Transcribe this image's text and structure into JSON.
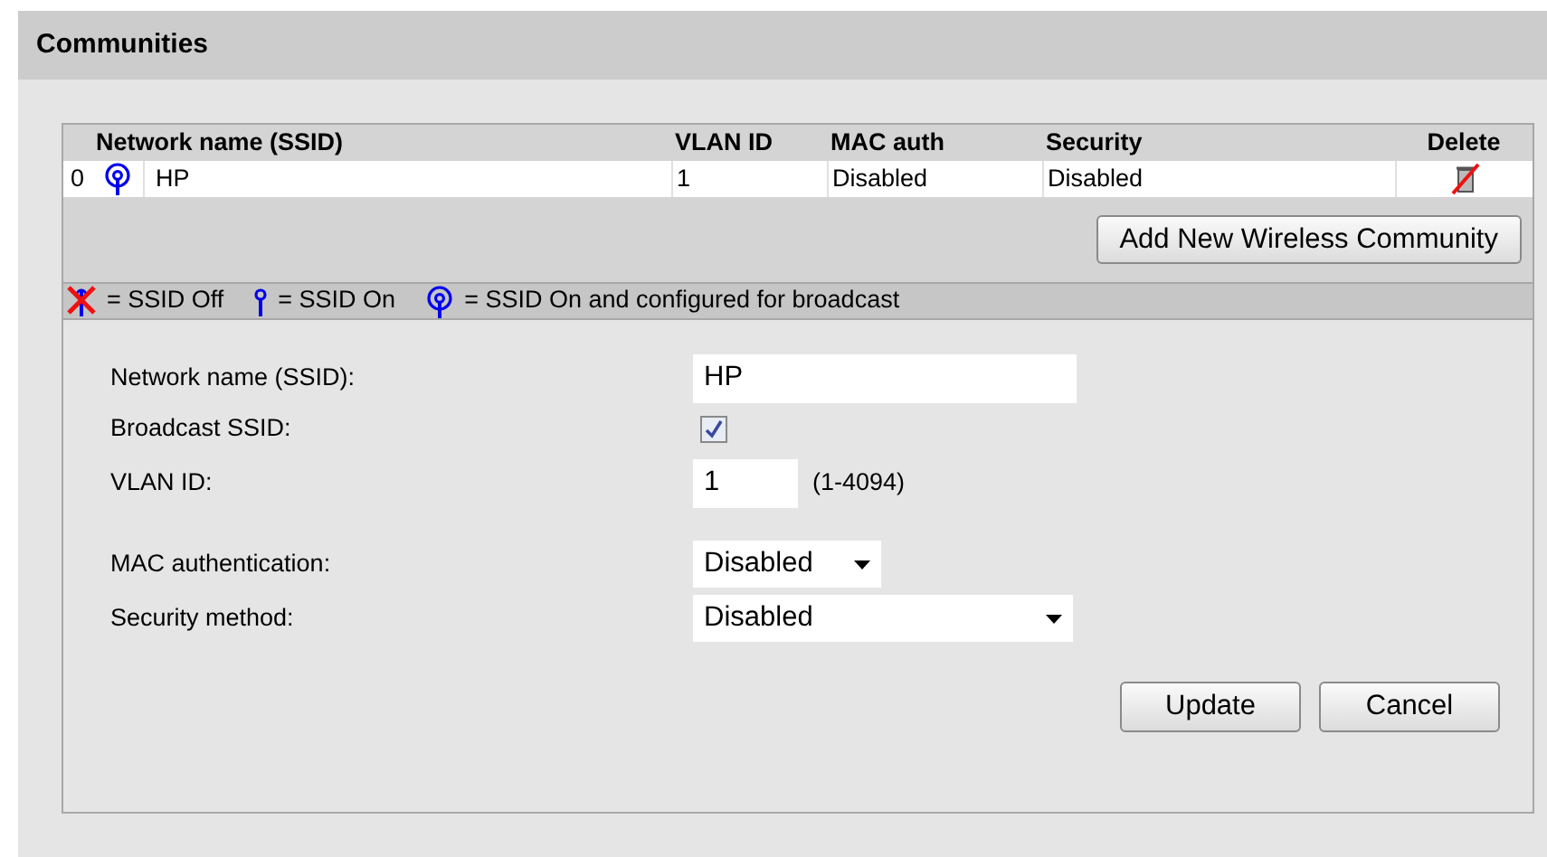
{
  "title": "Communities",
  "table": {
    "columns": [
      "Network name (SSID)",
      "VLAN ID",
      "MAC auth",
      "Security",
      "Delete"
    ],
    "rows": [
      {
        "index": "0",
        "kind": "broadcast",
        "name": "HP",
        "vlan": "1",
        "mac_auth": "Disabled",
        "security": "Disabled"
      }
    ]
  },
  "add_button": "Add New Wireless Community",
  "legend": [
    {
      "kind": "off",
      "label": "= SSID Off"
    },
    {
      "kind": "on",
      "label": "= SSID On"
    },
    {
      "kind": "broadcast",
      "label": "= SSID On and configured for broadcast"
    }
  ],
  "form": {
    "ssid_label": "Network name (SSID):",
    "ssid_value": "HP",
    "broadcast_label": "Broadcast SSID:",
    "broadcast_checked": true,
    "vlan_label": "VLAN ID:",
    "vlan_value": "1",
    "vlan_range": "(1-4094)",
    "mac_label": "MAC authentication:",
    "mac_value": "Disabled",
    "security_label": "Security method:",
    "security_value": "Disabled"
  },
  "buttons": [
    "Update",
    "Cancel"
  ]
}
